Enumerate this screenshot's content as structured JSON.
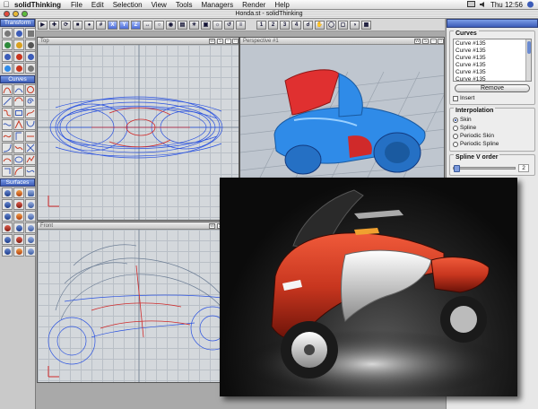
{
  "menubar": {
    "app_name": "solidThinking",
    "items": [
      "File",
      "Edit",
      "Selection",
      "View",
      "Tools",
      "Managers",
      "Render",
      "Help"
    ],
    "clock": "Thu 12:56"
  },
  "window": {
    "title": "Honda.st - solidThinking"
  },
  "toolbar": {
    "axis_buttons": [
      "X",
      "Y",
      "Z"
    ],
    "view_buttons": [
      "1",
      "2",
      "3",
      "4"
    ]
  },
  "palette": {
    "sections": [
      {
        "label": "Transform"
      },
      {
        "label": "Curves"
      },
      {
        "label": "Surfaces"
      }
    ]
  },
  "viewports": {
    "top": {
      "label": "Top"
    },
    "perspective": {
      "label": "Perspective #1"
    },
    "front": {
      "label": "Front"
    }
  },
  "panel": {
    "curves": {
      "title": "Curves",
      "items": [
        "Curve #135",
        "Curve #135",
        "Curve #135",
        "Curve #135",
        "Curve #135",
        "Curve #135"
      ],
      "remove_label": "Remove",
      "insert_label": "Insert"
    },
    "interpolation": {
      "title": "Interpolation",
      "options": [
        "Skin",
        "Spline",
        "Periodic Skin",
        "Periodic Spline"
      ],
      "selected": "Skin"
    },
    "spline_order": {
      "title": "Spline V order",
      "value": "2"
    }
  },
  "colors": {
    "accent": "#3c5cb8",
    "bike_red": "#c8361f",
    "bike_blue": "#2f8be8"
  }
}
